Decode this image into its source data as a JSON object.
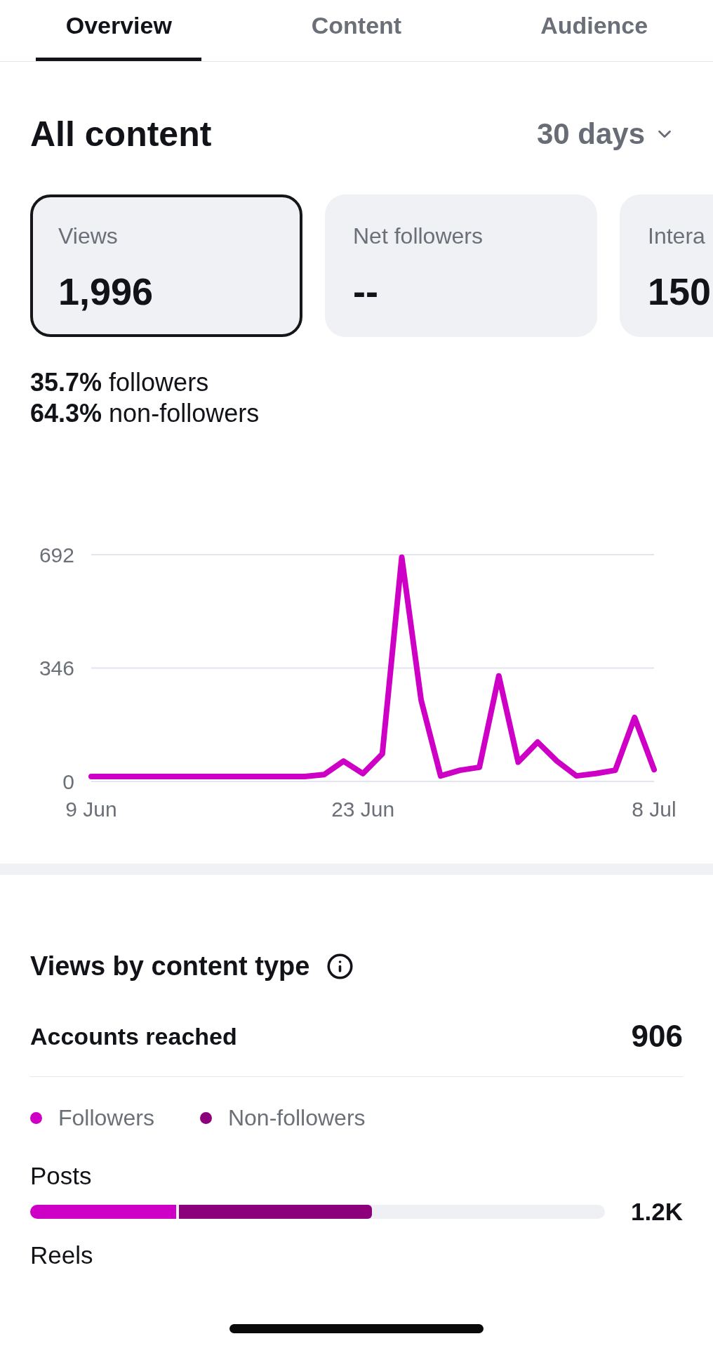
{
  "tabs": [
    {
      "label": "Overview",
      "selected": true
    },
    {
      "label": "Content",
      "selected": false
    },
    {
      "label": "Audience",
      "selected": false
    }
  ],
  "header": {
    "title": "All content",
    "period": "30 days"
  },
  "metrics": [
    {
      "label": "Views",
      "value": "1,996",
      "selected": true
    },
    {
      "label": "Net followers",
      "value": "--",
      "selected": false
    },
    {
      "label": "Intera",
      "value": "150",
      "selected": false
    }
  ],
  "audience_split": [
    "**35.7%** followers",
    "**64.3%** non-followers"
  ],
  "chart_data": {
    "type": "line",
    "categories": [
      "9 Jun",
      null,
      null,
      null,
      null,
      null,
      null,
      null,
      null,
      null,
      null,
      null,
      null,
      null,
      "23 Jun",
      null,
      null,
      null,
      null,
      null,
      null,
      null,
      null,
      null,
      null,
      null,
      null,
      null,
      null,
      "8 Jul"
    ],
    "series": [
      {
        "color": "#cf00c6",
        "values": [
          15,
          15,
          15,
          15,
          15,
          15,
          15,
          15,
          15,
          15,
          15,
          15,
          21,
          62,
          24,
          84,
          684,
          248,
          17,
          34,
          43,
          322,
          59,
          120,
          62,
          17,
          24,
          34,
          195,
          36
        ]
      }
    ],
    "ylim": [
      0,
      692
    ],
    "yticks": [
      0,
      346,
      692
    ]
  },
  "views_by_type": {
    "title": "Views by content type",
    "accounts_reached": {
      "label": "Accounts reached",
      "value": "906"
    },
    "legend": [
      {
        "label": "Followers",
        "color": "#cf00c6"
      },
      {
        "label": "Non-followers",
        "color": "#8d007c"
      }
    ],
    "rows": [
      {
        "label": "Posts",
        "value": "1.2K",
        "segments": [
          {
            "level": 0.254
          },
          {
            "level": 0.336
          }
        ]
      },
      {
        "label": "Reels"
      }
    ]
  }
}
